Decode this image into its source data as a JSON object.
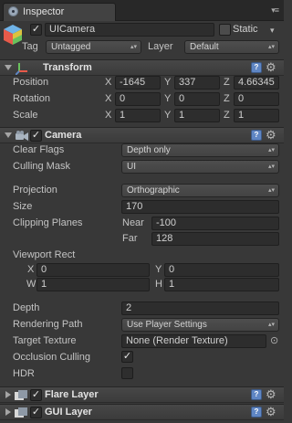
{
  "tab": {
    "label": "Inspector",
    "menu_glyph": "▾≡"
  },
  "object": {
    "enabled": true,
    "name": "UICamera",
    "static_label": "Static",
    "tag_label": "Tag",
    "tag_value": "Untagged",
    "layer_label": "Layer",
    "layer_value": "Default"
  },
  "transform": {
    "title": "Transform",
    "rows": [
      {
        "label": "Position",
        "x": "-1645",
        "y": "337",
        "z": "4.66345"
      },
      {
        "label": "Rotation",
        "x": "0",
        "y": "0",
        "z": "0"
      },
      {
        "label": "Scale",
        "x": "1",
        "y": "1",
        "z": "1"
      }
    ],
    "axis": {
      "x": "X",
      "y": "Y",
      "z": "Z"
    }
  },
  "camera": {
    "title": "Camera",
    "enabled": true,
    "clear_flags_label": "Clear Flags",
    "clear_flags_value": "Depth only",
    "culling_mask_label": "Culling Mask",
    "culling_mask_value": "UI",
    "projection_label": "Projection",
    "projection_value": "Orthographic",
    "size_label": "Size",
    "size_value": "170",
    "clipping_label": "Clipping Planes",
    "near_label": "Near",
    "near_value": "-100",
    "far_label": "Far",
    "far_value": "128",
    "viewport_label": "Viewport Rect",
    "vp_x_label": "X",
    "vp_x_value": "0",
    "vp_y_label": "Y",
    "vp_y_value": "0",
    "vp_w_label": "W",
    "vp_w_value": "1",
    "vp_h_label": "H",
    "vp_h_value": "1",
    "depth_label": "Depth",
    "depth_value": "2",
    "rendering_path_label": "Rendering Path",
    "rendering_path_value": "Use Player Settings",
    "target_texture_label": "Target Texture",
    "target_texture_value": "None (Render Texture)",
    "occlusion_label": "Occlusion Culling",
    "occlusion_checked": true,
    "hdr_label": "HDR",
    "hdr_checked": false
  },
  "flare_layer": {
    "title": "Flare Layer",
    "enabled": true
  },
  "gui_layer": {
    "title": "GUI Layer",
    "enabled": true
  },
  "glyphs": {
    "check": "✓",
    "dropdown_arrow": "▴▾",
    "help": "?",
    "gear": "⚙",
    "small_down": "▾",
    "target": "⊙"
  }
}
